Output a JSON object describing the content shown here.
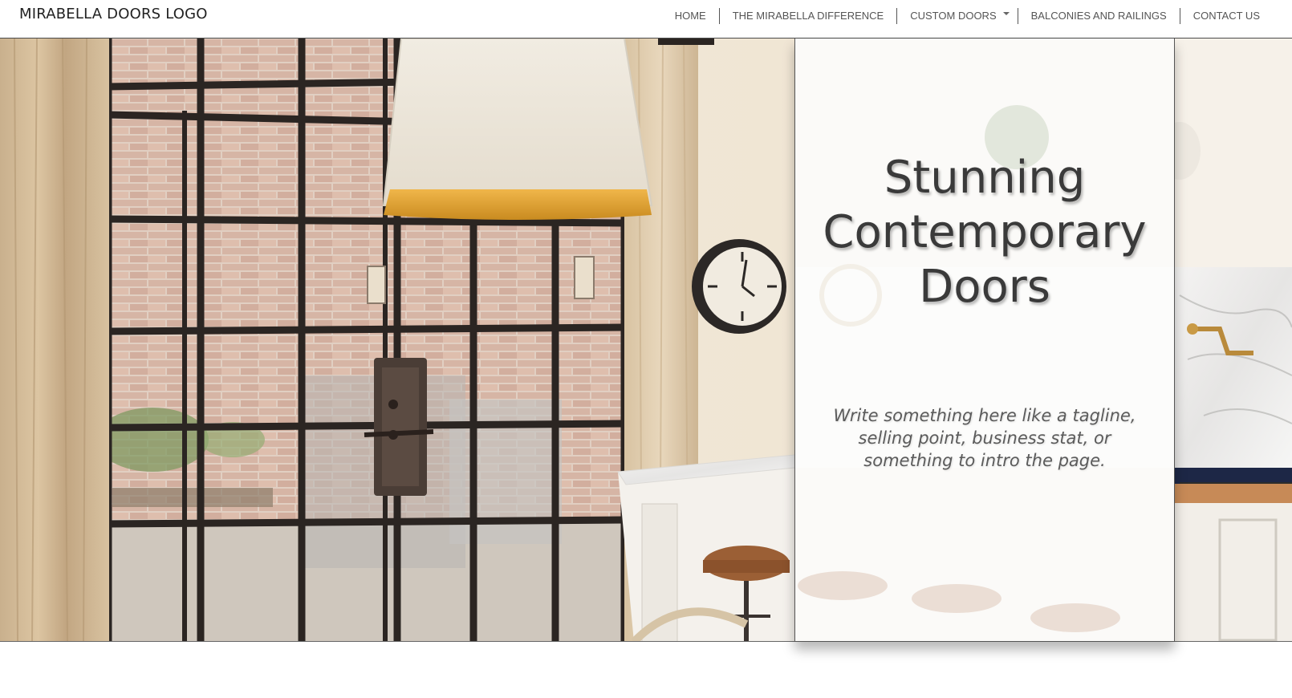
{
  "brand": {
    "logo_text": "MIRABELLA DOORS LOGO"
  },
  "nav": {
    "items": [
      {
        "label": "HOME"
      },
      {
        "label": "THE MIRABELLA DIFFERENCE"
      },
      {
        "label": "CUSTOM DOORS",
        "has_dropdown": true
      },
      {
        "label": "BALCONIES AND RAILINGS"
      },
      {
        "label": "CONTACT US"
      }
    ]
  },
  "hero": {
    "headline": "Stunning Contemporary Doors",
    "tagline": "Write something here like a tagline, selling point, business stat, or something to intro the page."
  },
  "colors": {
    "nav_text": "#555555",
    "headline": "#3a3a3a",
    "tagline": "#5b5b5b",
    "card_bg": "rgba(255,255,255,0.78)"
  }
}
